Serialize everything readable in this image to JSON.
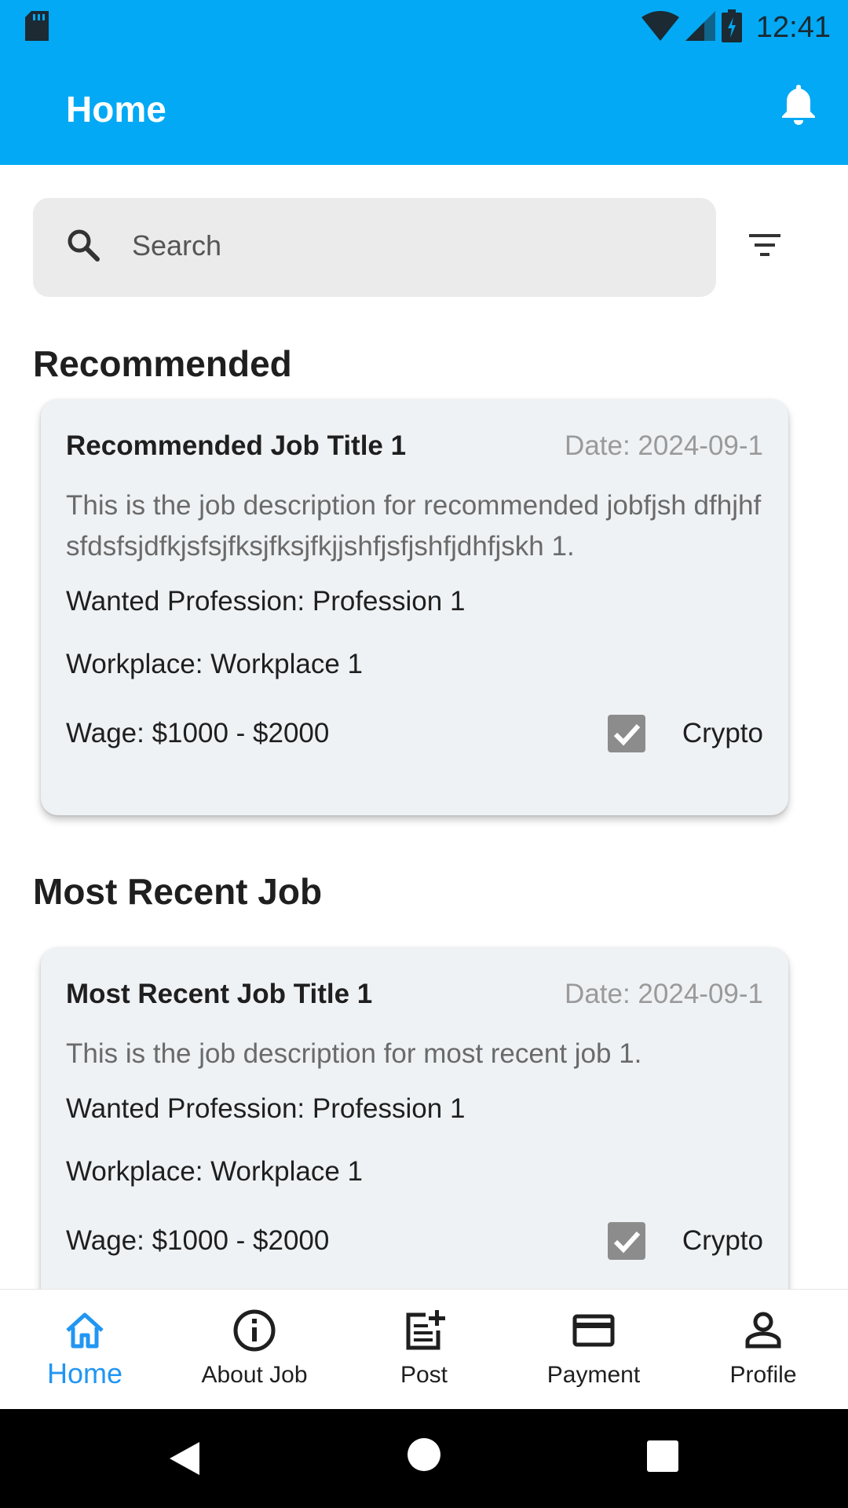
{
  "status_bar": {
    "time": "12:41",
    "icons": [
      "sd-card-icon",
      "wifi-icon",
      "signal-icon",
      "battery-icon"
    ]
  },
  "app_bar": {
    "title": "Home",
    "icon": "bell-icon"
  },
  "search": {
    "placeholder": "Search",
    "icon": "search-icon",
    "filter_icon": "filter-icon"
  },
  "sections": {
    "recommended": {
      "heading": "Recommended",
      "card": {
        "title": "Recommended Job Title 1",
        "date": "Date: 2024-09-1",
        "description": "This is the job description for recommended jobfjsh dfhjhfsfdsfsjdfkjsfsjfksjfksjfkjjshfjsfjshfjdhfjskh 1.",
        "profession": "Wanted Profession: Profession 1",
        "workplace": "Workplace: Workplace 1",
        "wage": "Wage: $1000 - $2000",
        "crypto_label": "Crypto",
        "crypto_checked": true
      }
    },
    "most_recent": {
      "heading": "Most Recent Job",
      "card": {
        "title": "Most Recent Job Title 1",
        "date": "Date: 2024-09-1",
        "description": "This is the job description for most recent job 1.",
        "profession": "Wanted Profession: Profession 1",
        "workplace": "Workplace: Workplace 1",
        "wage": "Wage: $1000 - $2000",
        "crypto_label": "Crypto",
        "crypto_checked": true
      }
    }
  },
  "bottom_nav": {
    "items": [
      {
        "label": "Home",
        "icon": "home-icon",
        "active": true
      },
      {
        "label": "About Job",
        "icon": "info-icon",
        "active": false
      },
      {
        "label": "Post",
        "icon": "post-add-icon",
        "active": false
      },
      {
        "label": "Payment",
        "icon": "credit-card-icon",
        "active": false
      },
      {
        "label": "Profile",
        "icon": "person-icon",
        "active": false
      }
    ]
  },
  "colors": {
    "primary": "#03a9f4",
    "active_nav": "#2196f3",
    "card_bg": "#eff2f5",
    "checkbox": "#8c8c8c"
  }
}
